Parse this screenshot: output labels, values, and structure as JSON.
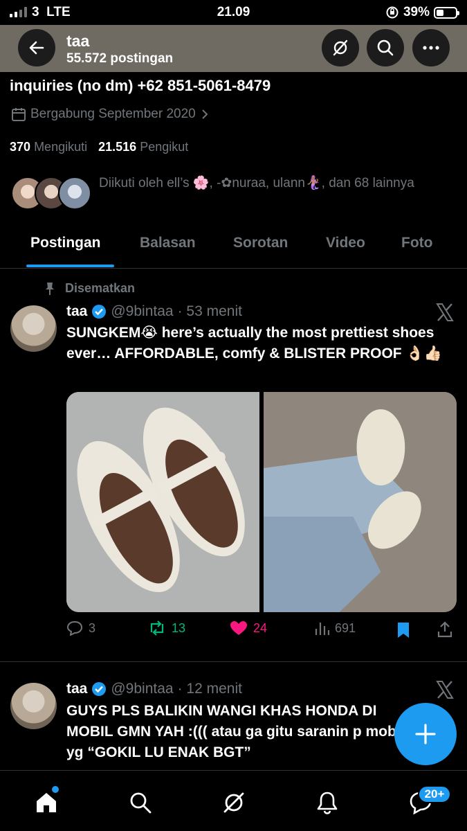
{
  "status_bar": {
    "carrier": "3",
    "network": "LTE",
    "time": "21.09",
    "battery": "39%",
    "battery_level": 0.39
  },
  "header": {
    "name": "taa",
    "posts_count": "55.572 postingan"
  },
  "profile": {
    "bio_visible_line": "inquiries (no dm) +62 851-5061-8479",
    "joined": "Bergabung September 2020",
    "following_count": "370",
    "following_label": "Mengikuti",
    "followers_count": "21.516",
    "followers_label": "Pengikut",
    "followed_by": "Diikuti oleh ell’s 🌸, -✿nuraa, ulann🧜🏽‍♀️, dan 68 lainnya"
  },
  "tabs": [
    "Postingan",
    "Balasan",
    "Sorotan",
    "Video",
    "Foto"
  ],
  "pinned_label": "Disematkan",
  "posts": [
    {
      "name": "taa",
      "handle": "@9bintaa",
      "time": "· 53 menit",
      "text": "SUNGKEM😭 here’s actually the most prettiest shoes ever… AFFORDABLE, comfy & BLISTER PROOF 👌🏻👍🏻",
      "replies": "3",
      "reposts": "13",
      "likes": "24",
      "views": "691"
    },
    {
      "name": "taa",
      "handle": "@9bintaa",
      "time": "· 12 menit",
      "text": "GUYS PLS BALIKIN WANGI KHAS HONDA DI MOBIL GMN YAH :((( atau ga gitu saranin p mobil yg “GOKIL LU ENAK BGT”"
    }
  ],
  "bottom_nav": {
    "messages_badge": "20+"
  },
  "colors": {
    "accent": "#1d9bf0",
    "repost_green": "#00ba7c",
    "like_pink": "#f91880",
    "muted": "#71767b"
  }
}
